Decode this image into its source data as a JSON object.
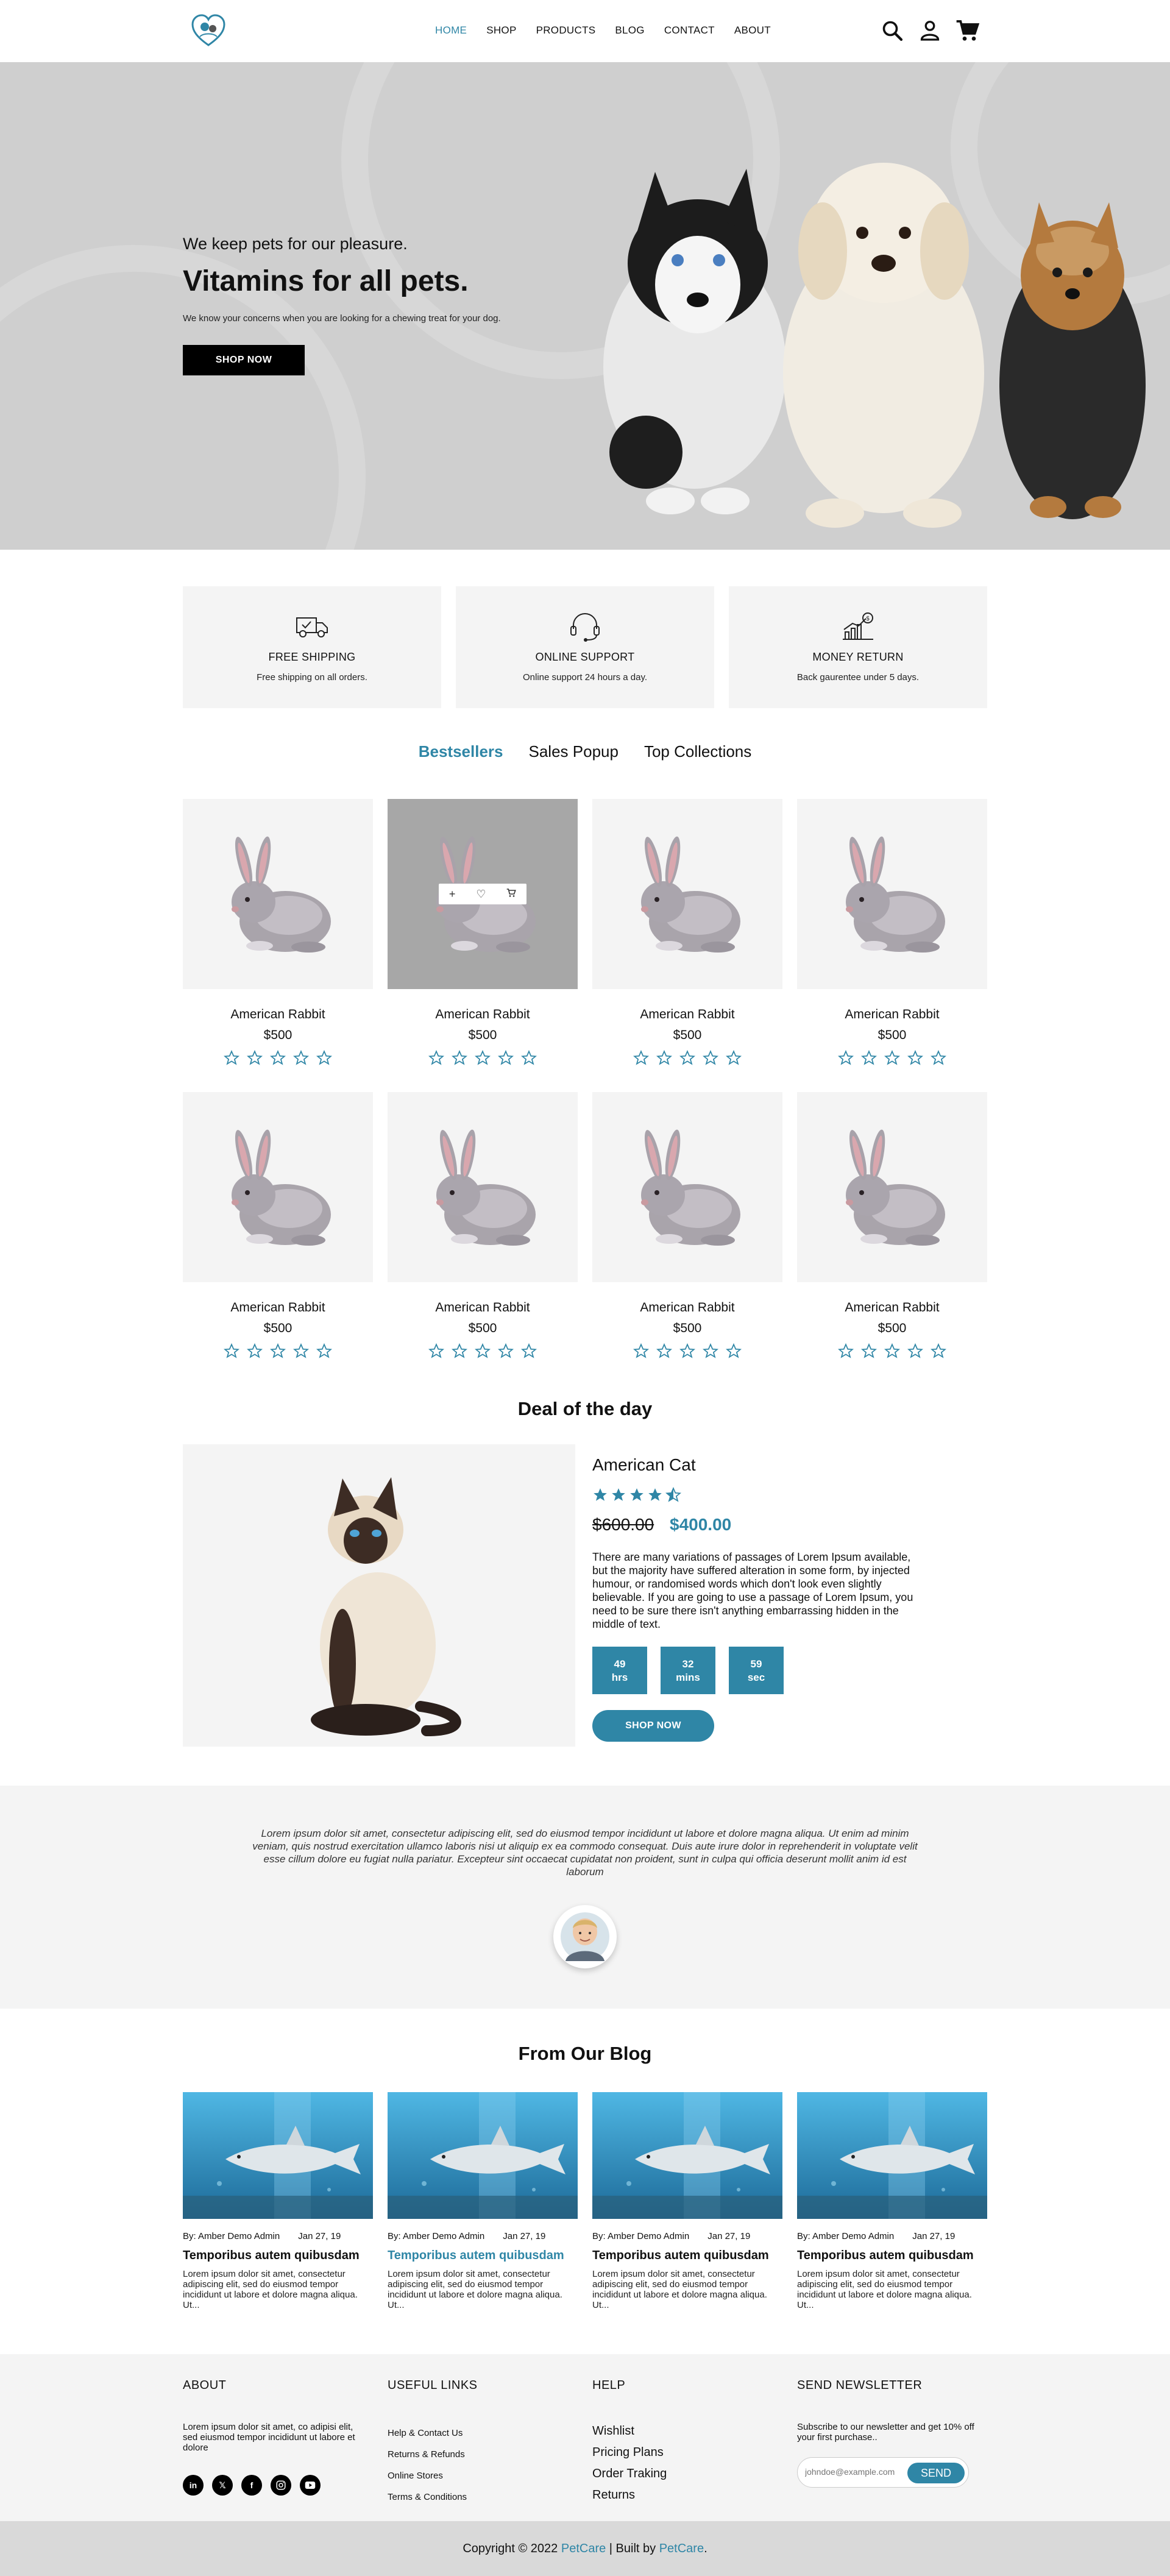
{
  "header": {
    "nav": [
      "HOME",
      "SHOP",
      "PRODUCTS",
      "BLOG",
      "CONTACT",
      "ABOUT"
    ],
    "active_nav": "HOME",
    "icons": [
      "search-icon",
      "user-icon",
      "cart-icon"
    ]
  },
  "hero": {
    "subtitle": "We keep pets for our pleasure.",
    "title": "Vitamins for all pets.",
    "description": "We know your concerns when you are looking for a chewing treat for your dog.",
    "button": "SHOP NOW"
  },
  "features": [
    {
      "icon": "truck-icon",
      "title": "FREE SHIPPING",
      "desc": "Free shipping on all orders."
    },
    {
      "icon": "headset-icon",
      "title": "ONLINE SUPPORT",
      "desc": "Online support 24 hours a day."
    },
    {
      "icon": "money-chart-icon",
      "title": "MONEY RETURN",
      "desc": "Back gaurentee under 5 days."
    }
  ],
  "tabs": [
    "Bestsellers",
    "Sales Popup",
    "Top Collections"
  ],
  "products": [
    {
      "name": "American Rabbit",
      "price": "$500"
    },
    {
      "name": "American Rabbit",
      "price": "$500"
    },
    {
      "name": "American Rabbit",
      "price": "$500"
    },
    {
      "name": "American Rabbit",
      "price": "$500"
    },
    {
      "name": "American Rabbit",
      "price": "$500"
    },
    {
      "name": "American Rabbit",
      "price": "$500"
    },
    {
      "name": "American Rabbit",
      "price": "$500"
    },
    {
      "name": "American Rabbit",
      "price": "$500"
    }
  ],
  "deal": {
    "section_title": "Deal of the day",
    "name": "American Cat",
    "rating": 4.5,
    "old_price": "$600.00",
    "new_price": "$400.00",
    "description": "There are many variations of passages of Lorem Ipsum available, but the majority have suffered alteration in some form, by injected humour, or randomised words which don't look even slightly believable. If you are going to use a passage of Lorem Ipsum, you need to be sure there isn't anything embarrassing hidden in the middle of text.",
    "countdown": [
      {
        "value": "49",
        "unit": "hrs"
      },
      {
        "value": "32",
        "unit": "mins"
      },
      {
        "value": "59",
        "unit": "sec"
      }
    ],
    "button": "SHOP NOW"
  },
  "testimonial": {
    "text": "Lorem ipsum dolor sit amet, consectetur adipiscing elit, sed do eiusmod tempor incididunt ut labore et dolore magna aliqua. Ut enim ad minim veniam, quis nostrud exercitation ullamco laboris nisi ut aliquip ex ea commodo consequat. Duis aute irure dolor in reprehenderit in voluptate velit esse cillum dolore eu fugiat nulla pariatur. Excepteur sint occaecat cupidatat non proident, sunt in culpa qui officia deserunt mollit anim id est laborum"
  },
  "blog": {
    "title": "From Our Blog",
    "posts": [
      {
        "author": "By: Amber Demo Admin",
        "date": "Jan 27, 19",
        "title": "Temporibus autem quibusdam",
        "excerpt": "Lorem ipsum dolor sit amet, consectetur adipiscing elit, sed do eiusmod tempor incididunt ut labore et dolore magna aliqua. Ut..."
      },
      {
        "author": "By: Amber Demo Admin",
        "date": "Jan 27, 19",
        "title": "Temporibus autem quibusdam",
        "excerpt": "Lorem ipsum dolor sit amet, consectetur adipiscing elit, sed do eiusmod tempor incididunt ut labore et dolore magna aliqua. Ut..."
      },
      {
        "author": "By: Amber Demo Admin",
        "date": "Jan 27, 19",
        "title": "Temporibus autem quibusdam",
        "excerpt": "Lorem ipsum dolor sit amet, consectetur adipiscing elit, sed do eiusmod tempor incididunt ut labore et dolore magna aliqua. Ut..."
      },
      {
        "author": "By: Amber Demo Admin",
        "date": "Jan 27, 19",
        "title": "Temporibus autem quibusdam",
        "excerpt": "Lorem ipsum dolor sit amet, consectetur adipiscing elit, sed do eiusmod tempor incididunt ut labore et dolore magna aliqua. Ut..."
      }
    ]
  },
  "footer": {
    "about": {
      "title": "ABOUT",
      "text": "Lorem ipsum dolor sit amet, co adipisi elit, sed eiusmod tempor incididunt ut labore et dolore"
    },
    "social": [
      "linkedin-icon",
      "x-icon",
      "facebook-icon",
      "instagram-icon",
      "youtube-icon"
    ],
    "useful_links": {
      "title": "USEFUL LINKS",
      "items": [
        "Help & Contact Us",
        "Returns & Refunds",
        "Online Stores",
        "Terms & Conditions"
      ]
    },
    "help": {
      "title": "HELP",
      "items": [
        "Wishlist",
        "Pricing Plans",
        "Order Traking",
        "Returns"
      ]
    },
    "newsletter": {
      "title": "SEND NEWSLETTER",
      "text": "Subscribe to our newsletter and get 10% off your first purchase..",
      "placeholder": "johndoe@example.com",
      "button": "SEND"
    }
  },
  "copyright": {
    "prefix": "Copyright © 2022",
    "brand": "PetCare",
    "middle": "| Built by",
    "builder": "PetCare",
    "suffix": "."
  },
  "colors": {
    "accent": "#2f86a6",
    "hero_bg": "#cfcfcf",
    "card_bg": "#f4f4f4"
  }
}
